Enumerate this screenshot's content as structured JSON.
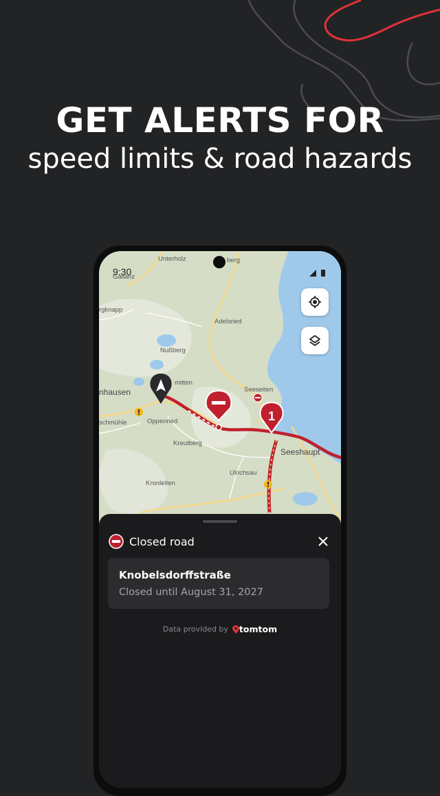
{
  "headline": "GET ALERTS FOR",
  "subheadline": "speed limits & road hazards",
  "status_bar": {
    "time": "9:30"
  },
  "map": {
    "labels": {
      "unterholz": "Unterholz",
      "berg": "berg",
      "gallanz": "Gallanz",
      "rgknapp": "rgknapp",
      "adelsried": "Adelsried",
      "nussberg": "Nußberg",
      "mitten": "mitten",
      "nhausen": "nhausen",
      "seeseiten": "Seeseiten",
      "schmuhle": "schmühle",
      "oppenried": "Oppenried",
      "kreutberg": "Kreutberg",
      "seeshaupt": "Seeshaupt",
      "ulrichsau": "Ulrichsau",
      "kronleiten": "Kronleiten"
    },
    "incident_count": "1",
    "icons": [
      "navigation-arrow-icon",
      "no-entry-icon",
      "warning-icon",
      "my-location-icon",
      "layers-icon"
    ]
  },
  "sheet": {
    "title": "Closed road",
    "street": "Knobelsdorffstraße",
    "closed_until": "Closed until August 31, 2027",
    "provider_label": "Data provided by",
    "provider_brand": "tomtom"
  },
  "colors": {
    "background": "#222325",
    "route_red": "#c0202e",
    "map_land": "#d6ddc6",
    "water": "#9fc9eb",
    "sheet": "#1b1b1d",
    "card": "#2c2c2f",
    "contour_red": "#e0323b"
  }
}
